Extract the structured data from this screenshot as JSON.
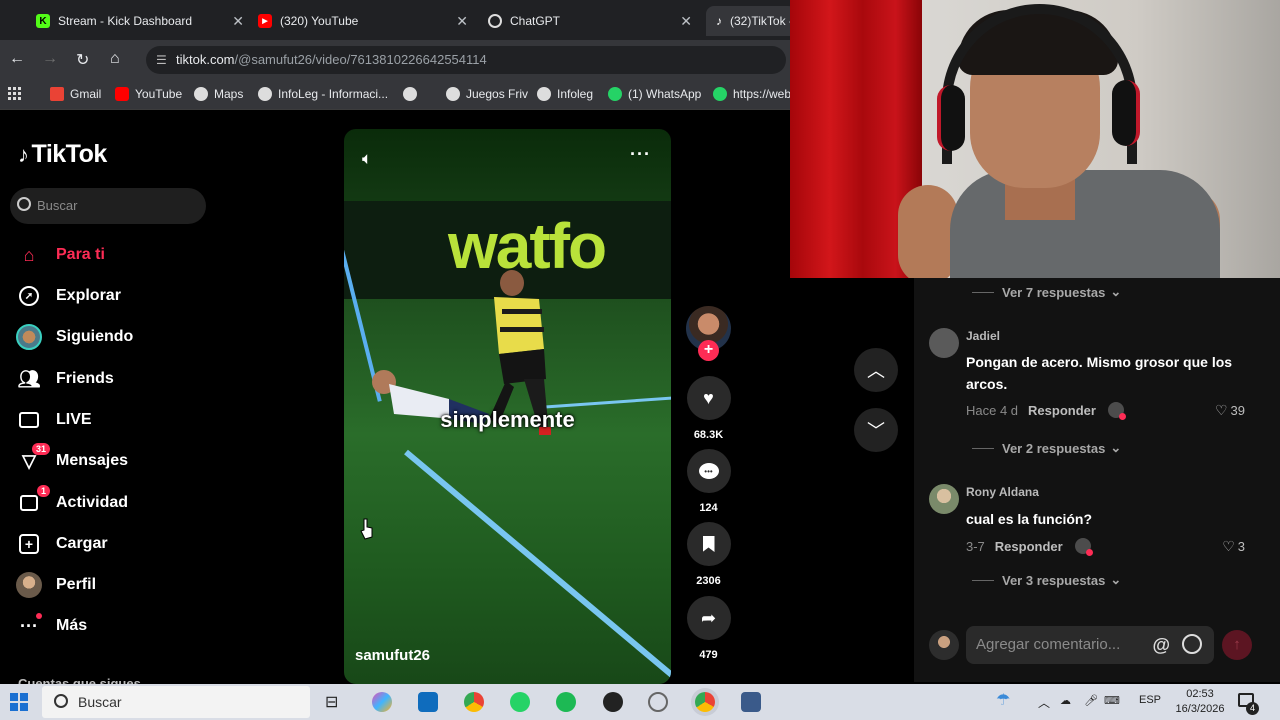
{
  "browser": {
    "tabs": [
      {
        "label": "Stream - Kick Dashboard",
        "icon": "kick-icon",
        "color": "#53fc18"
      },
      {
        "label": "(320) YouTube",
        "icon": "youtube-icon",
        "color": "#ff0000"
      },
      {
        "label": "ChatGPT",
        "icon": "chatgpt-icon",
        "color": "#ffffff"
      },
      {
        "label": "(32)TikTok -",
        "icon": "tiktok-icon",
        "color": "#ffffff"
      }
    ],
    "url_host": "tiktok.com",
    "url_path": "/@samufut26/video/7613810226642554114",
    "bookmarks": [
      {
        "label": "Gmail",
        "icon": "gmail-icon"
      },
      {
        "label": "YouTube",
        "icon": "youtube-icon"
      },
      {
        "label": "Maps",
        "icon": "maps-icon"
      },
      {
        "label": "InfoLeg - Informaci...",
        "icon": "globe-icon"
      },
      {
        "label": "",
        "icon": "globe-icon"
      },
      {
        "label": "Juegos Friv",
        "icon": "globe-icon"
      },
      {
        "label": "Infoleg",
        "icon": "globe-icon"
      },
      {
        "label": "(1) WhatsApp",
        "icon": "whatsapp-icon"
      },
      {
        "label": "https://web",
        "icon": "whatsapp-icon"
      }
    ]
  },
  "tiktok": {
    "logo": "TikTok",
    "search_placeholder": "Buscar",
    "nav": [
      {
        "label": "Para ti",
        "icon": "home-icon"
      },
      {
        "label": "Explorar",
        "icon": "compass-icon"
      },
      {
        "label": "Siguiendo",
        "icon": "following-icon"
      },
      {
        "label": "Friends",
        "icon": "friends-icon"
      },
      {
        "label": "LIVE",
        "icon": "live-icon"
      },
      {
        "label": "Mensajes",
        "icon": "messages-icon",
        "badge": "31"
      },
      {
        "label": "Actividad",
        "icon": "activity-icon",
        "badge": "1"
      },
      {
        "label": "Cargar",
        "icon": "upload-icon"
      },
      {
        "label": "Perfil",
        "icon": "profile-icon"
      },
      {
        "label": "Más",
        "icon": "more-icon"
      }
    ],
    "following_section": "Cuentas que sigues",
    "accent": "#fe2c55"
  },
  "video": {
    "banner_text": "watfo",
    "caption": "simplemente",
    "author": "samufut26",
    "likes": "68.3K",
    "comments": "124",
    "saves": "2306",
    "shares": "479"
  },
  "comments": {
    "view_replies_top": "Ver 7 respuestas",
    "items": [
      {
        "user": "Jadiel",
        "text": "Pongan de acero. Mismo grosor que los arcos.",
        "time": "Hace 4 d",
        "reply": "Responder",
        "likes": "39",
        "replies": "Ver 2 respuestas"
      },
      {
        "user": "Rony Aldana",
        "text": "cual es la función?",
        "time": "3-7",
        "reply": "Responder",
        "likes": "3",
        "replies": "Ver 3 respuestas"
      }
    ],
    "input_placeholder": "Agregar comentario..."
  },
  "taskbar": {
    "search_label": "Buscar",
    "language": "ESP",
    "time": "02:53",
    "date": "16/3/2026",
    "notifications": "4"
  }
}
